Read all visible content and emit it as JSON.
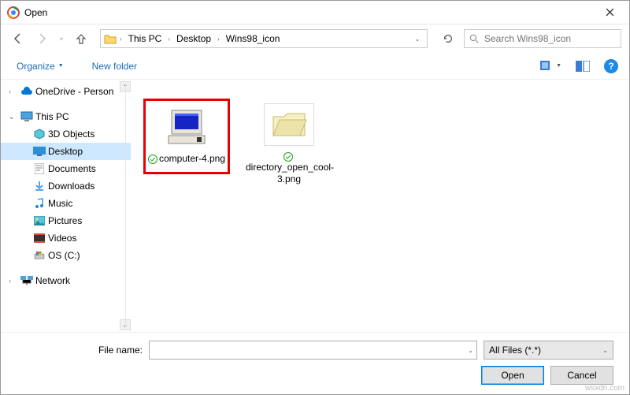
{
  "window": {
    "title": "Open"
  },
  "breadcrumbs": {
    "b1": "This PC",
    "b2": "Desktop",
    "b3": "Wins98_icon"
  },
  "search": {
    "placeholder": "Search Wins98_icon"
  },
  "toolbar": {
    "organize": "Organize",
    "new_folder": "New folder"
  },
  "sidebar": {
    "onedrive": "OneDrive - Person",
    "thispc": "This PC",
    "objects3d": "3D Objects",
    "desktop": "Desktop",
    "documents": "Documents",
    "downloads": "Downloads",
    "music": "Music",
    "pictures": "Pictures",
    "videos": "Videos",
    "osdrive": "OS (C:)",
    "network": "Network"
  },
  "files": {
    "f1": "computer-4.png",
    "f2": "directory_open_cool-3.png"
  },
  "footer": {
    "filename_label": "File name:",
    "filetype": "All Files (*.*)",
    "open": "Open",
    "cancel": "Cancel"
  },
  "watermark": "wsxdn.com"
}
